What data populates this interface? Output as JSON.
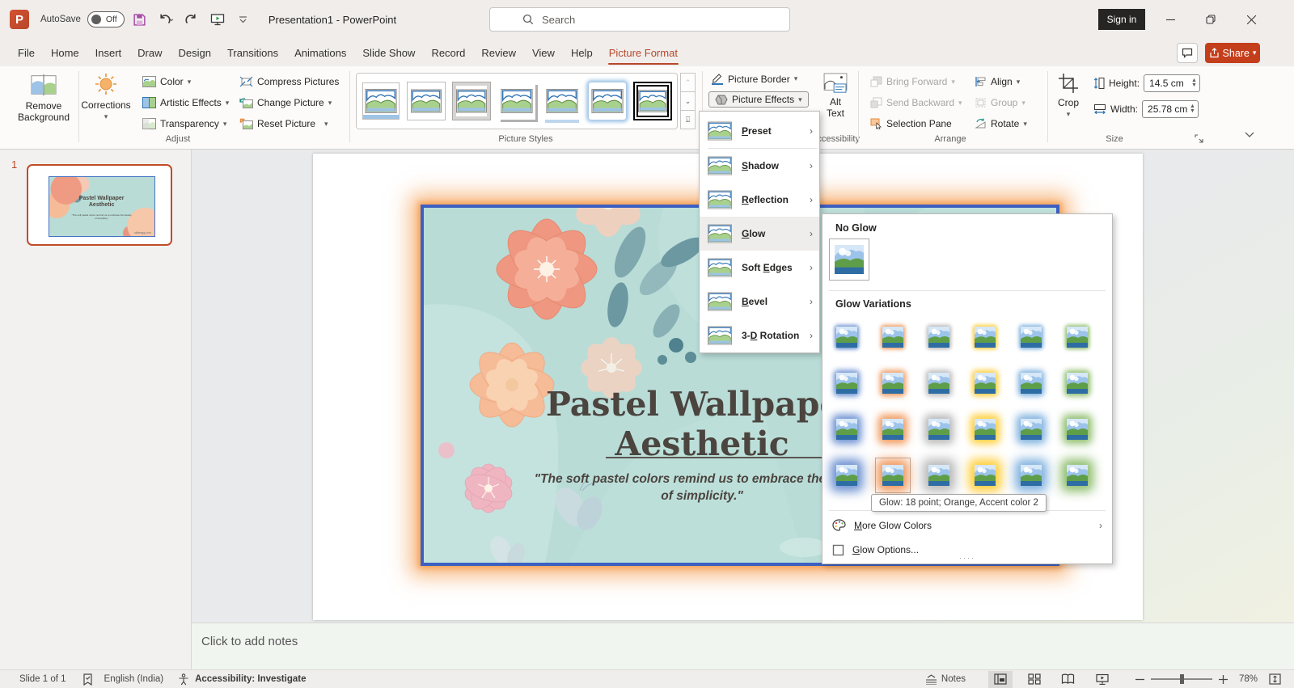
{
  "titlebar": {
    "autosave_label": "AutoSave",
    "autosave_state": "Off",
    "doc_title": "Presentation1  -  PowerPoint",
    "search_placeholder": "Search",
    "signin_label": "Sign in"
  },
  "tabs": {
    "items": [
      "File",
      "Home",
      "Insert",
      "Draw",
      "Design",
      "Transitions",
      "Animations",
      "Slide Show",
      "Record",
      "Review",
      "View",
      "Help",
      "Picture Format"
    ],
    "active": "Picture Format"
  },
  "share_label": "Share",
  "ribbon": {
    "adjust": {
      "remove_background_l1": "Remove",
      "remove_background_l2": "Background",
      "corrections": "Corrections",
      "color": "Color",
      "artistic_effects": "Artistic Effects",
      "transparency": "Transparency",
      "compress_pictures": "Compress Pictures",
      "change_picture": "Change Picture",
      "reset_picture": "Reset Picture",
      "group_label": "Adjust"
    },
    "picture_styles": {
      "group_label": "Picture Styles"
    },
    "border_effects": {
      "picture_border": "Picture Border",
      "picture_effects": "Picture Effects"
    },
    "accessibility": {
      "alt_l1": "Alt",
      "alt_l2": "Text",
      "group_label": "Accessibility"
    },
    "arrange": {
      "bring_forward": "Bring Forward",
      "send_backward": "Send Backward",
      "selection_pane": "Selection Pane",
      "align": "Align",
      "group": "Group",
      "rotate": "Rotate",
      "group_label": "Arrange"
    },
    "size": {
      "crop": "Crop",
      "height_label": "Height:",
      "height_value": "14.5 cm",
      "width_label": "Width:",
      "width_value": "25.78 cm",
      "group_label": "Size"
    }
  },
  "effects_menu": {
    "items": [
      {
        "label": "Preset",
        "accel": "P"
      },
      {
        "label": "Shadow",
        "accel": "S"
      },
      {
        "label": "Reflection",
        "accel": "R"
      },
      {
        "label": "Glow",
        "accel": "G",
        "open": true
      },
      {
        "label": "Soft Edges",
        "accel": "E"
      },
      {
        "label": "Bevel",
        "accel": "B"
      },
      {
        "label": "3-D Rotation",
        "accel": "D"
      }
    ]
  },
  "glow_menu": {
    "no_glow_header": "No Glow",
    "variations_header": "Glow Variations",
    "variation_colors": [
      "#4472c4",
      "#ed7d31",
      "#a5a5a5",
      "#ffc000",
      "#5b9bd5",
      "#70ad47"
    ],
    "hovered_tooltip": "Glow: 18 point; Orange, Accent color 2",
    "more_glow_colors": "More Glow Colors",
    "more_accel": "M",
    "glow_options": "Glow Options...",
    "options_accel": "G"
  },
  "slide": {
    "number": "1",
    "title_line1": "Pastel Wallpaper",
    "title_line2": "Aesthetic",
    "quote_line1": "\"The soft pastel colors remind us to embrace the beauty",
    "quote_line2": "of simplicity.\"",
    "watermark": "slideegg.com"
  },
  "notes": {
    "placeholder": "Click to add notes"
  },
  "statusbar": {
    "slide_indicator": "Slide 1 of 1",
    "language": "English (India)",
    "accessibility": "Accessibility: Investigate",
    "notes_label": "Notes",
    "zoom_level": "78%"
  }
}
